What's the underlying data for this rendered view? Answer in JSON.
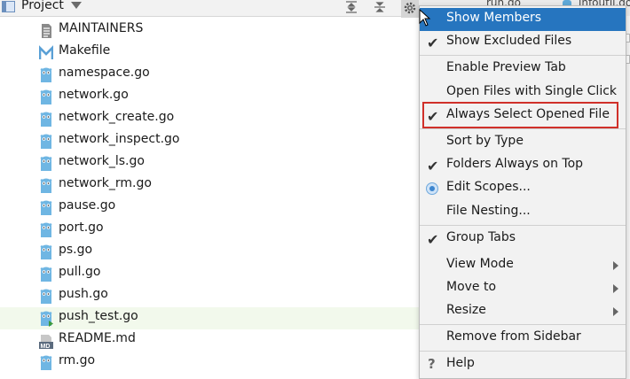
{
  "header": {
    "title": "Project"
  },
  "editor_tabs": [
    "run.go",
    "infoutil.go"
  ],
  "files": [
    {
      "name": "MAINTAINERS",
      "icon": "text-file-icon"
    },
    {
      "name": "Makefile",
      "icon": "makefile-icon"
    },
    {
      "name": "namespace.go",
      "icon": "go-file-icon"
    },
    {
      "name": "network.go",
      "icon": "go-file-icon"
    },
    {
      "name": "network_create.go",
      "icon": "go-file-icon"
    },
    {
      "name": "network_inspect.go",
      "icon": "go-file-icon"
    },
    {
      "name": "network_ls.go",
      "icon": "go-file-icon"
    },
    {
      "name": "network_rm.go",
      "icon": "go-file-icon"
    },
    {
      "name": "pause.go",
      "icon": "go-file-icon"
    },
    {
      "name": "port.go",
      "icon": "go-file-icon"
    },
    {
      "name": "ps.go",
      "icon": "go-file-icon"
    },
    {
      "name": "pull.go",
      "icon": "go-file-icon"
    },
    {
      "name": "push.go",
      "icon": "go-file-icon"
    },
    {
      "name": "push_test.go",
      "icon": "go-test-file-icon",
      "selected": true
    },
    {
      "name": "README.md",
      "icon": "markdown-file-icon"
    },
    {
      "name": "rm.go",
      "icon": "go-file-icon"
    }
  ],
  "menu": {
    "items": [
      {
        "label": "Show Members",
        "highlighted": true
      },
      {
        "label": "Show Excluded Files",
        "checked": true
      },
      {
        "label": "Enable Preview Tab"
      },
      {
        "label": "Open Files with Single Click"
      },
      {
        "label": "Always Select Opened File",
        "checked": true,
        "boxed": true
      },
      {
        "label": "Sort by Type"
      },
      {
        "label": "Folders Always on Top",
        "checked": true
      },
      {
        "label": "Edit Scopes...",
        "radio": true
      },
      {
        "label": "File Nesting..."
      },
      {
        "label": "Group Tabs",
        "checked": true
      },
      {
        "label": "View Mode",
        "submenu": true
      },
      {
        "label": "Move to",
        "submenu": true
      },
      {
        "label": "Resize",
        "submenu": true
      },
      {
        "label": "Remove from Sidebar"
      },
      {
        "label": "Help",
        "help": true
      }
    ]
  },
  "colors": {
    "highlight": "#2675bf",
    "selected_row": "#f2f9ec",
    "callout_box": "#d0302a"
  }
}
